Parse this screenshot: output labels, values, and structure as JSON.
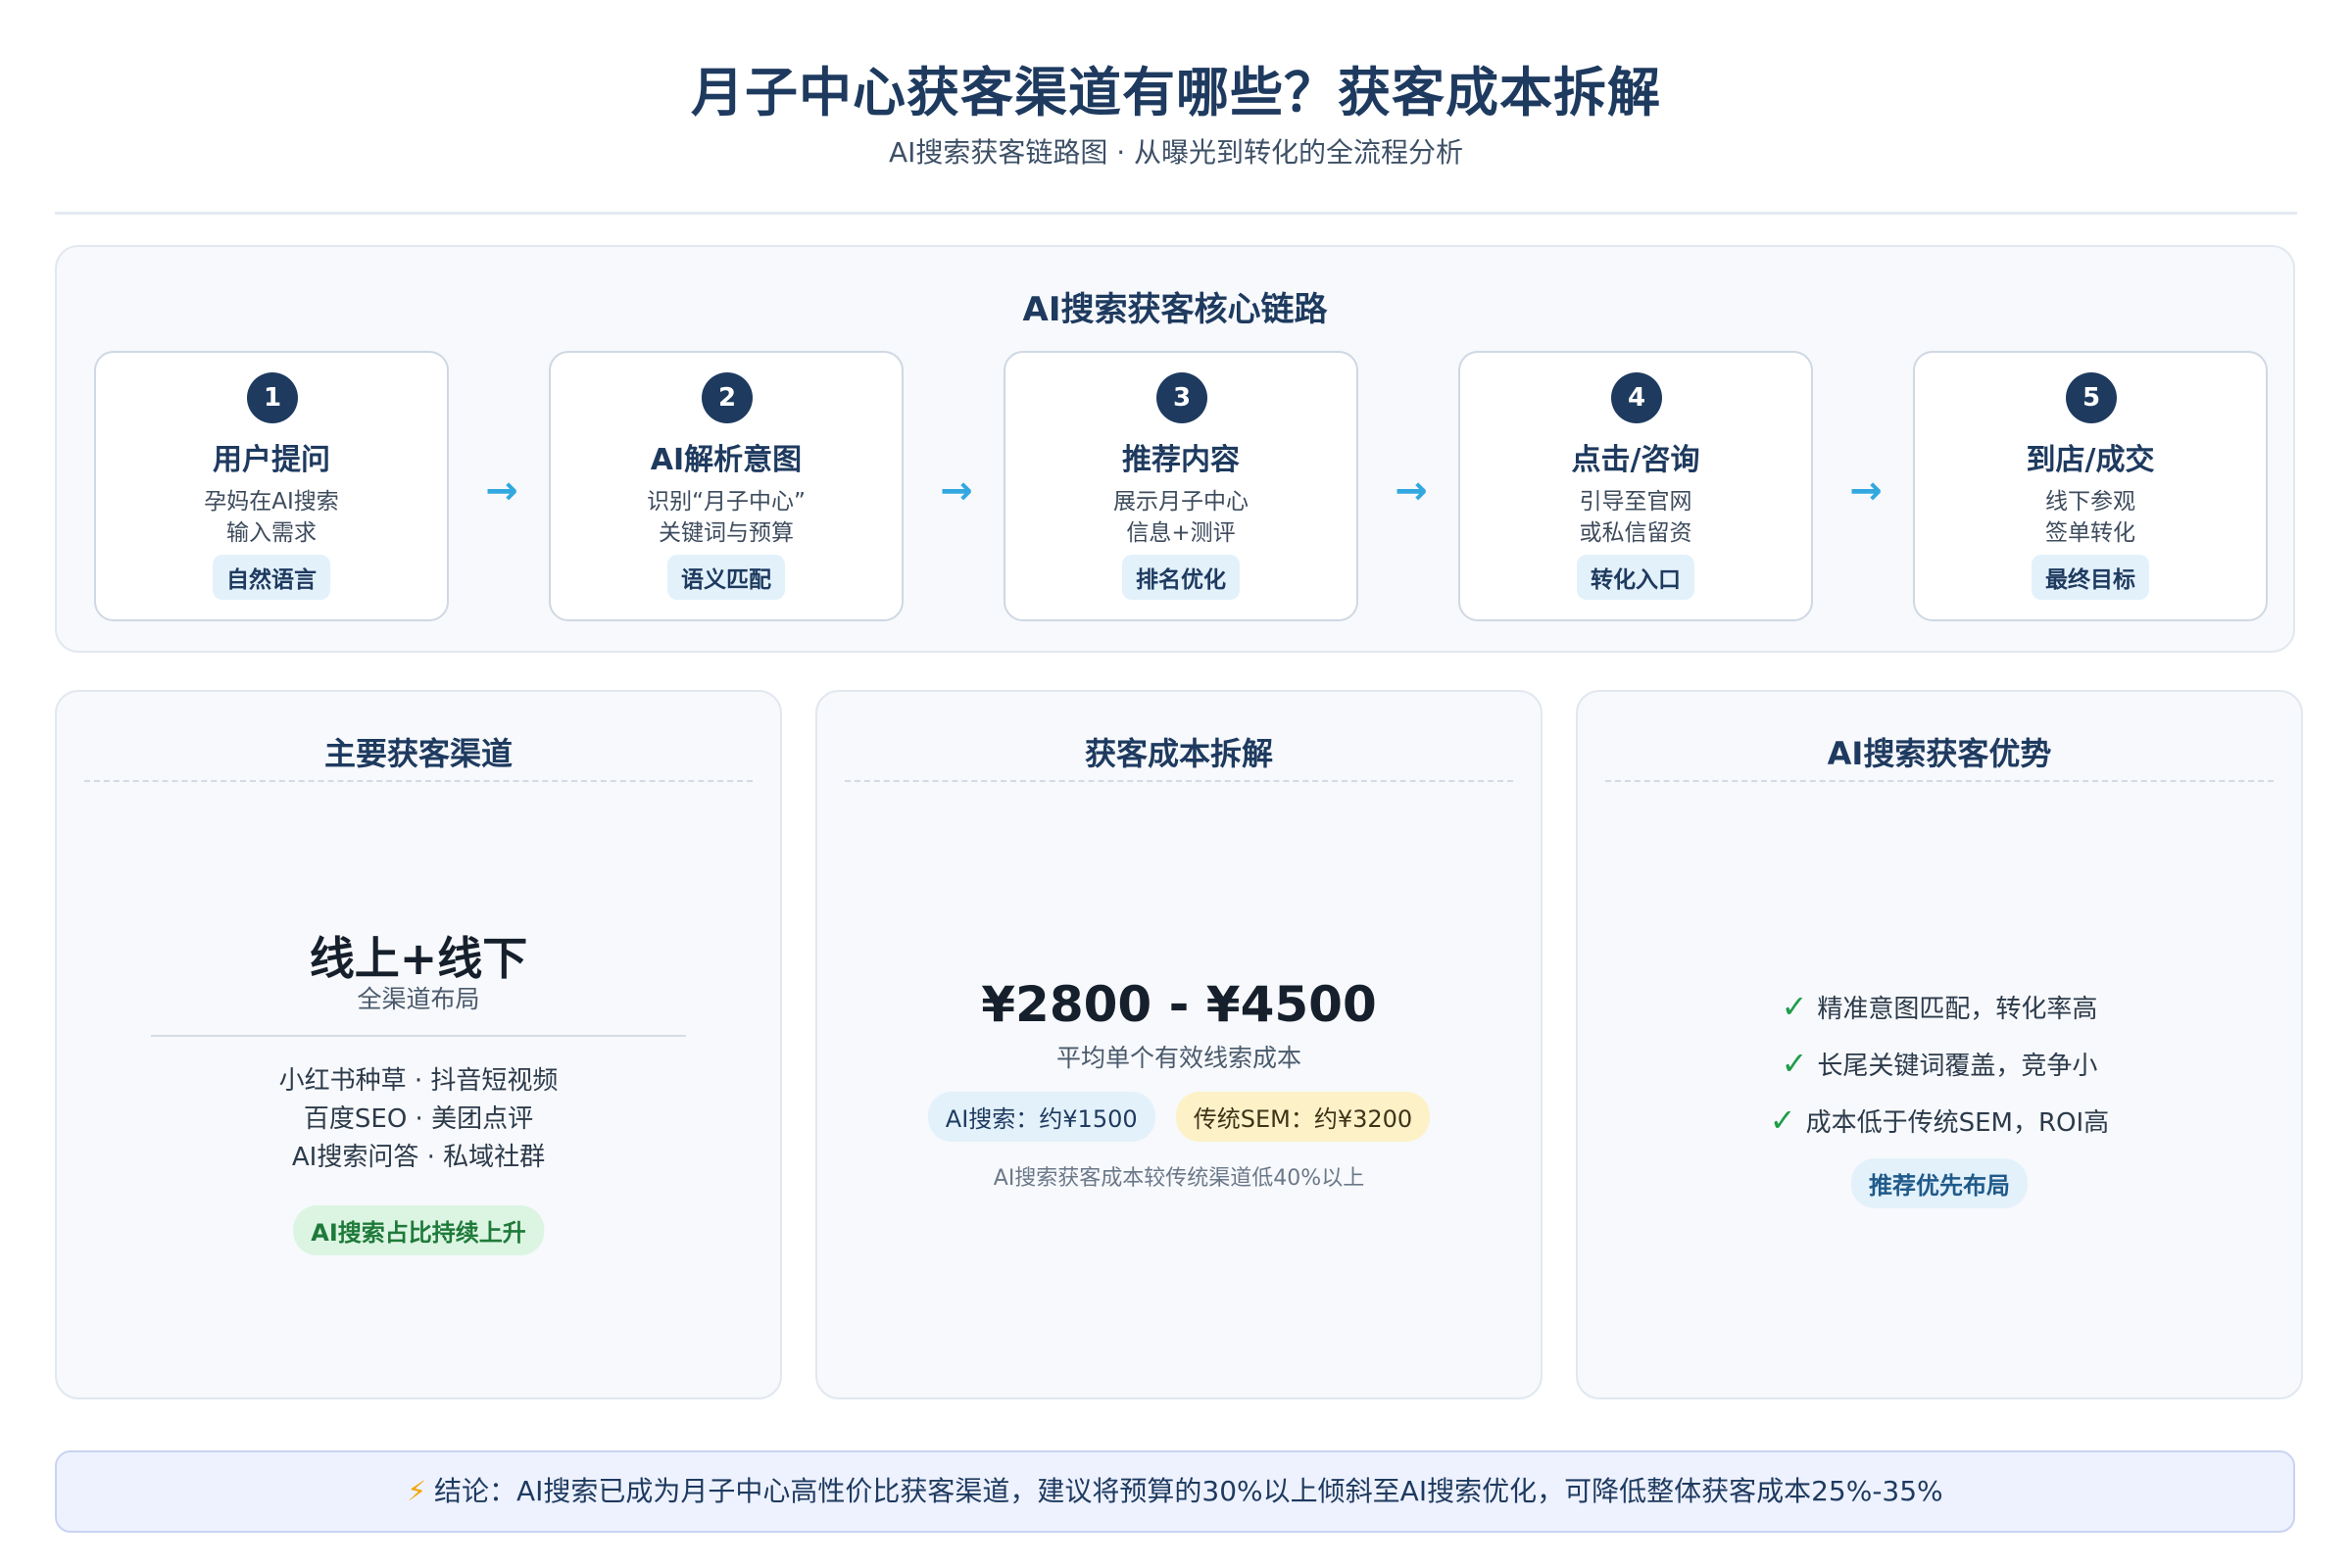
{
  "header": {
    "title": "月子中心获客渠道有哪些？获客成本拆解",
    "subtitle": "AI搜索获客链路图 · 从曝光到转化的全流程分析"
  },
  "flow": {
    "title": "AI搜索获客核心链路",
    "arrow": "→",
    "steps": [
      {
        "num": "1",
        "title": "用户提问",
        "desc": [
          "孕妈在AI搜索",
          "输入需求"
        ],
        "tag": "自然语言"
      },
      {
        "num": "2",
        "title": "AI解析意图",
        "desc": [
          "识别“月子中心”",
          "关键词与预算"
        ],
        "tag": "语义匹配"
      },
      {
        "num": "3",
        "title": "推荐内容",
        "desc": [
          "展示月子中心",
          "信息+测评"
        ],
        "tag": "排名优化"
      },
      {
        "num": "4",
        "title": "点击/咨询",
        "desc": [
          "引导至官网",
          "或私信留资"
        ],
        "tag": "转化入口"
      },
      {
        "num": "5",
        "title": "到店/成交",
        "desc": [
          "线下参观",
          "签单转化"
        ],
        "tag": "最终目标"
      }
    ]
  },
  "channels": {
    "title": "主要获客渠道",
    "headline": "线上+线下",
    "sub": "全渠道布局",
    "lines": [
      "小红书种草 · 抖音短视频",
      "百度SEO · 美团点评",
      "AI搜索问答 · 私域社群"
    ],
    "tag": "AI搜索占比持续上升"
  },
  "cost": {
    "title": "获客成本拆解",
    "range": "¥2800 - ¥4500",
    "sub": "平均单个有效线索成本",
    "ai_pill": "AI搜索：约¥1500",
    "sem_pill": "传统SEM：约¥3200",
    "note": "AI搜索获客成本较传统渠道低40%以上"
  },
  "advantages": {
    "title": "AI搜索获客优势",
    "check": "✓",
    "items": [
      "精准意图匹配，转化率高",
      "长尾关键词覆盖，竞争小",
      "成本低于传统SEM，ROI高"
    ],
    "tag": "推荐优先布局"
  },
  "conclusion": {
    "icon": "⚡",
    "text": "结论：AI搜索已成为月子中心高性价比获客渠道，建议将预算的30%以上倾斜至AI搜索优化，可降低整体获客成本25%-35%"
  },
  "colors": {
    "primary": "#1e3a5f",
    "arrow": "#33a8e0",
    "check": "#1f9d4a",
    "green_tag_bg": "#dcf5e3",
    "yellow_pill_bg": "#fdf1c8",
    "blue_pill_bg": "#e3f1fb"
  }
}
